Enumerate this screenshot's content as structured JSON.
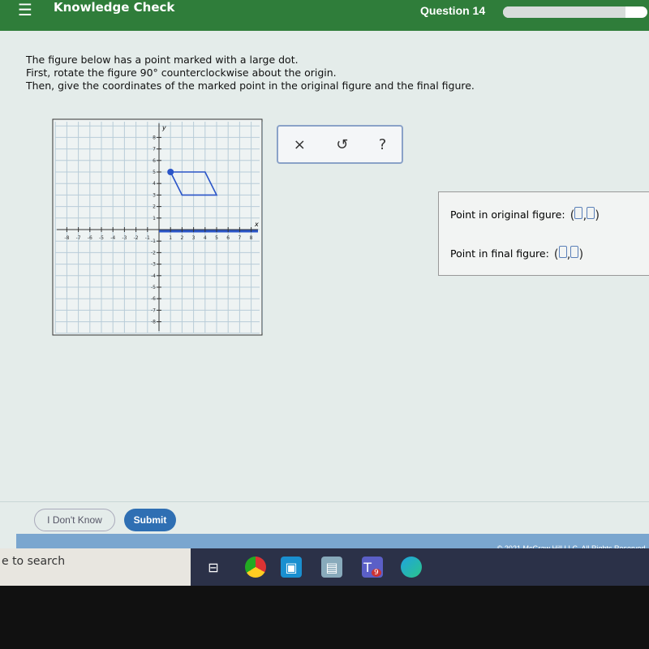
{
  "header": {
    "menu_icon": "hamburger-icon",
    "title": "Knowledge Check",
    "question": "Question 14",
    "progress_fraction": 0.85
  },
  "prompt": {
    "lines": [
      "The figure below has a point marked with a large dot.",
      "First, rotate the figure 90° counterclockwise about the origin.",
      "Then, give the coordinates of the marked point in the original figure and the final figure."
    ]
  },
  "graph": {
    "x_label": "x",
    "y_label": "y",
    "xlim": [
      -8,
      8
    ],
    "ylim": [
      -8,
      8
    ],
    "figure_vertices": [
      [
        1,
        5
      ],
      [
        4,
        5
      ],
      [
        5,
        3
      ],
      [
        2,
        3
      ]
    ],
    "marked_point": [
      1,
      5
    ],
    "figure_color": "#2a55c8"
  },
  "tools": {
    "clear": "×",
    "undo": "↺",
    "help": "?"
  },
  "answers": {
    "original_label": "Point in original figure:",
    "final_label": "Point in final figure:"
  },
  "footer": {
    "dont_know": "I Don't Know",
    "submit": "Submit",
    "copyright": "© 2021 McGraw Hill LLC. All Rights Reserved."
  },
  "taskbar": {
    "search": "e to search",
    "icons": [
      "task-view-icon",
      "chrome-icon",
      "remote-desktop-icon",
      "network-app-icon",
      "teams-icon",
      "edge-icon"
    ],
    "teams_badge": "9"
  }
}
